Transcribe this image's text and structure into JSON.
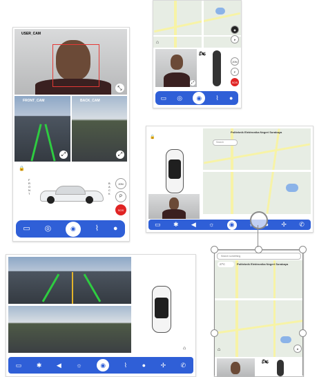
{
  "main": {
    "user_cam_label": "USER_CAM",
    "front_cam_label": "FRONT_CAM",
    "back_cam_label": "BACK_CAM",
    "vertical_front": "F R O N T",
    "vertical_back": "B A C K",
    "speed_label": "20N",
    "park_label": "P",
    "sos_label": "SOS"
  },
  "landscape": {
    "search_placeholder": "Search",
    "map_title": "Politeknik Elektronika Negeri Surabaya"
  },
  "selected": {
    "search_placeholder": "Search something",
    "temperature": "27°C",
    "map_title": "Politeknik Elektronika Negeri Surabaya"
  },
  "nav_icons": [
    "car-icon",
    "steering-icon",
    "dashboard-icon",
    "seat-icon",
    "person-icon"
  ],
  "colors": {
    "accent": "#2f5fd7",
    "sos": "#e02424"
  }
}
